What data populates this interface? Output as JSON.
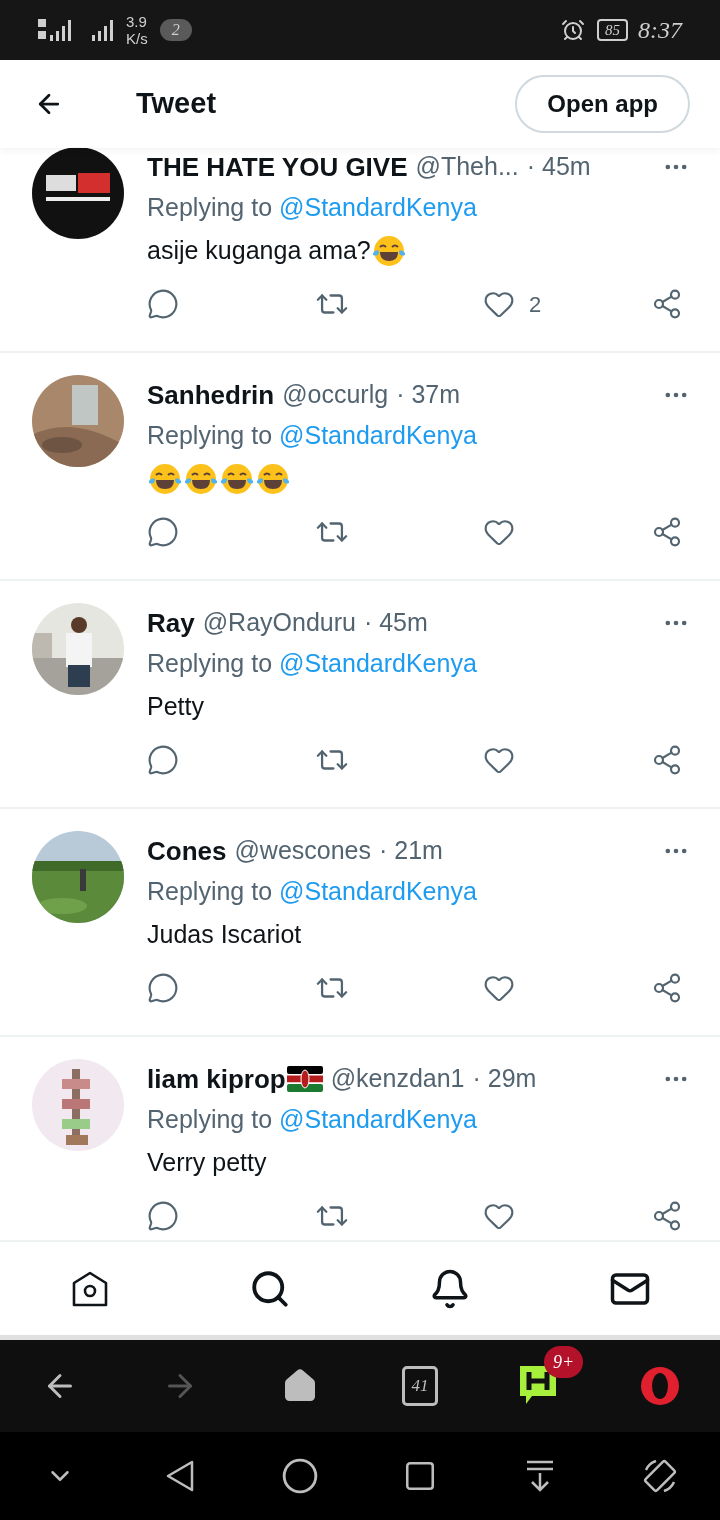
{
  "status_bar": {
    "speed_value": "3.9",
    "speed_unit": "K/s",
    "notification_count": "2",
    "battery": "85",
    "time": "8:37"
  },
  "header": {
    "title": "Tweet",
    "open_app": "Open app"
  },
  "tweets": [
    {
      "name": "THE HATE YOU GIVE",
      "name_flag": false,
      "handle": "@Theh...",
      "time": "· 45m",
      "reply_prefix": "Replying to",
      "mention": "@StandardKenya",
      "body": "asije kuganga ama?",
      "emojis": [
        {
          "kind": "tears-of-joy"
        }
      ],
      "likes": "2"
    },
    {
      "name": "Sanhedrin",
      "name_flag": false,
      "handle": "@occurlg",
      "time": "· 37m",
      "reply_prefix": "Replying to",
      "mention": "@StandardKenya",
      "emojis": [
        {
          "kind": "tears-of-joy"
        },
        {
          "kind": "tears-of-joy"
        },
        {
          "kind": "tears-of-joy"
        },
        {
          "kind": "tears-of-joy"
        }
      ]
    },
    {
      "name": "Ray",
      "name_flag": false,
      "handle": "@RayOnduru",
      "time": "· 45m",
      "reply_prefix": "Replying to",
      "mention": "@StandardKenya",
      "body": "Petty"
    },
    {
      "name": "Cones",
      "name_flag": false,
      "handle": "@wescones",
      "time": "· 21m",
      "reply_prefix": "Replying to",
      "mention": "@StandardKenya",
      "body": "Judas Iscariot"
    },
    {
      "name": "liam kiprop",
      "name_flag": true,
      "handle": "@kenzdan1",
      "time": "· 29m",
      "reply_prefix": "Replying to",
      "mention": "@StandardKenya",
      "body": "Verry petty"
    }
  ],
  "browser_bar": {
    "tab_count": "41",
    "notification_badge": "9+"
  }
}
